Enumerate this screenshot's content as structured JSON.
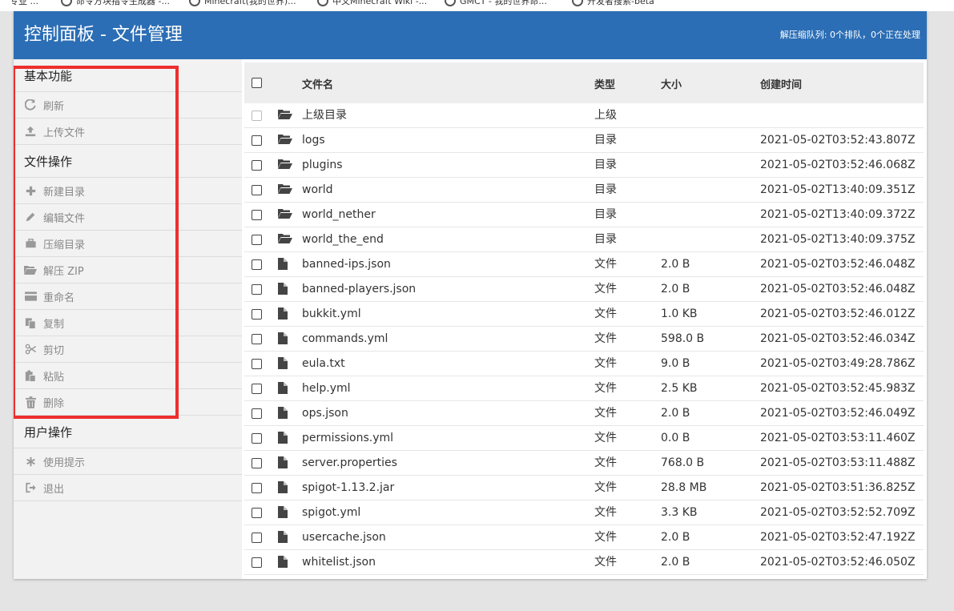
{
  "browser": {
    "bookmarks": [
      {
        "label": "专业 ..."
      },
      {
        "label": "命令方块指令生成器 -..."
      },
      {
        "label": "Minecraft(我的世界)..."
      },
      {
        "label": "中文Minecraft Wiki -..."
      },
      {
        "label": "GMCT - 我的世界命..."
      },
      {
        "label": "开发者搜索-beta"
      }
    ]
  },
  "header": {
    "title": "控制面板 - 文件管理",
    "queue_status": "解压缩队列: 0个排队，0个正在处理"
  },
  "sidebar": {
    "sections": [
      {
        "heading": "基本功能",
        "items": [
          {
            "label": "刷新",
            "icon": "refresh-icon"
          },
          {
            "label": "上传文件",
            "icon": "upload-icon"
          }
        ]
      },
      {
        "heading": "文件操作",
        "items": [
          {
            "label": "新建目录",
            "icon": "plus-icon"
          },
          {
            "label": "编辑文件",
            "icon": "pencil-icon"
          },
          {
            "label": "压缩目录",
            "icon": "briefcase-icon"
          },
          {
            "label": "解压 ZIP",
            "icon": "folder-open-icon"
          },
          {
            "label": "重命名",
            "icon": "rename-card-icon"
          },
          {
            "label": "复制",
            "icon": "copy-icon"
          },
          {
            "label": "剪切",
            "icon": "scissors-icon"
          },
          {
            "label": "粘贴",
            "icon": "paste-icon"
          },
          {
            "label": "删除",
            "icon": "trash-icon"
          }
        ]
      },
      {
        "heading": "用户操作",
        "items": [
          {
            "label": "使用提示",
            "icon": "asterisk-icon"
          },
          {
            "label": "退出",
            "icon": "logout-icon"
          }
        ]
      }
    ],
    "highlight_color": "#ee2e2e"
  },
  "table": {
    "headers": {
      "name": "文件名",
      "type": "类型",
      "size": "大小",
      "created": "创建时间"
    },
    "rows": [
      {
        "name": "上级目录",
        "type": "上级",
        "size": "",
        "created": "",
        "icon": "folder-icon"
      },
      {
        "name": "logs",
        "type": "目录",
        "size": "",
        "created": "2021-05-02T03:52:43.807Z",
        "icon": "folder-icon"
      },
      {
        "name": "plugins",
        "type": "目录",
        "size": "",
        "created": "2021-05-02T03:52:46.068Z",
        "icon": "folder-icon"
      },
      {
        "name": "world",
        "type": "目录",
        "size": "",
        "created": "2021-05-02T13:40:09.351Z",
        "icon": "folder-icon"
      },
      {
        "name": "world_nether",
        "type": "目录",
        "size": "",
        "created": "2021-05-02T13:40:09.372Z",
        "icon": "folder-icon"
      },
      {
        "name": "world_the_end",
        "type": "目录",
        "size": "",
        "created": "2021-05-02T13:40:09.375Z",
        "icon": "folder-icon"
      },
      {
        "name": "banned-ips.json",
        "type": "文件",
        "size": "2.0 B",
        "created": "2021-05-02T03:52:46.048Z",
        "icon": "file-icon"
      },
      {
        "name": "banned-players.json",
        "type": "文件",
        "size": "2.0 B",
        "created": "2021-05-02T03:52:46.048Z",
        "icon": "file-icon"
      },
      {
        "name": "bukkit.yml",
        "type": "文件",
        "size": "1.0 KB",
        "created": "2021-05-02T03:52:46.012Z",
        "icon": "file-icon"
      },
      {
        "name": "commands.yml",
        "type": "文件",
        "size": "598.0 B",
        "created": "2021-05-02T03:52:46.034Z",
        "icon": "file-icon"
      },
      {
        "name": "eula.txt",
        "type": "文件",
        "size": "9.0 B",
        "created": "2021-05-02T03:49:28.786Z",
        "icon": "file-icon"
      },
      {
        "name": "help.yml",
        "type": "文件",
        "size": "2.5 KB",
        "created": "2021-05-02T03:52:45.983Z",
        "icon": "file-icon"
      },
      {
        "name": "ops.json",
        "type": "文件",
        "size": "2.0 B",
        "created": "2021-05-02T03:52:46.049Z",
        "icon": "file-icon"
      },
      {
        "name": "permissions.yml",
        "type": "文件",
        "size": "0.0 B",
        "created": "2021-05-02T03:53:11.460Z",
        "icon": "file-icon"
      },
      {
        "name": "server.properties",
        "type": "文件",
        "size": "768.0 B",
        "created": "2021-05-02T03:53:11.488Z",
        "icon": "file-icon"
      },
      {
        "name": "spigot-1.13.2.jar",
        "type": "文件",
        "size": "28.8 MB",
        "created": "2021-05-02T03:51:36.825Z",
        "icon": "file-icon"
      },
      {
        "name": "spigot.yml",
        "type": "文件",
        "size": "3.3 KB",
        "created": "2021-05-02T03:52:52.709Z",
        "icon": "file-icon"
      },
      {
        "name": "usercache.json",
        "type": "文件",
        "size": "2.0 B",
        "created": "2021-05-02T03:52:47.192Z",
        "icon": "file-icon"
      },
      {
        "name": "whitelist.json",
        "type": "文件",
        "size": "2.0 B",
        "created": "2021-05-02T03:52:46.050Z",
        "icon": "file-icon"
      }
    ]
  },
  "colors": {
    "header_bg": "#2c6eb5",
    "sidebar_bg": "#f2f2f2"
  }
}
